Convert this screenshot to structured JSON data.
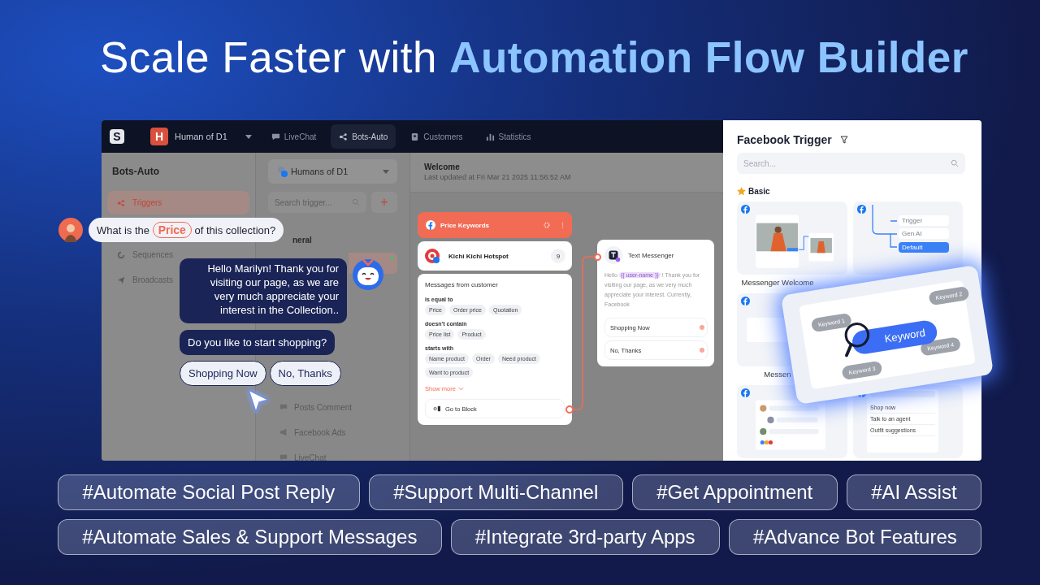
{
  "title": {
    "lead": "Scale Faster with",
    "accent": "Automation Flow Builder"
  },
  "app": {
    "logo": "S",
    "workspace": {
      "initial": "H",
      "name": "Human of D1"
    },
    "nav": [
      {
        "label": "LiveChat",
        "selected": false
      },
      {
        "label": "Bots-Auto",
        "selected": true
      },
      {
        "label": "Customers",
        "selected": false
      },
      {
        "label": "Statistics",
        "selected": false
      }
    ],
    "sidebar": {
      "title": "Bots-Auto",
      "items": [
        {
          "label": "Triggers",
          "selected": true
        },
        {
          "label": "Sequences",
          "selected": false
        },
        {
          "label": "Broadcasts",
          "selected": false
        }
      ]
    },
    "triggers": {
      "page": "Humans of D1",
      "search_placeholder": "Search trigger...",
      "add": "+",
      "group": "neral",
      "channels": [
        "Posts Comment",
        "Facebook Ads",
        "LiveChat"
      ]
    },
    "canvas": {
      "title": "Welcome",
      "updated": "Last updated at Fri Mar 21 2025 11:56:52 AM",
      "trigger_node": {
        "title": "Price Keywords",
        "page": "Kichi Kichi Hotspot",
        "count": "9",
        "heading": "Messages from customer",
        "rules": [
          {
            "label": "is equal to",
            "tags": [
              "Price",
              "Order price",
              "Quotation"
            ]
          },
          {
            "label": "doesn't contain",
            "tags": [
              "Price list",
              "Product"
            ]
          },
          {
            "label": "starts with",
            "tags": [
              "Name product",
              "Order",
              "Need product",
              "Want to product"
            ]
          }
        ],
        "more": "Show more",
        "action": "Go to Block"
      },
      "message_node": {
        "title": "Text Messenger",
        "greeting": "Hello",
        "variable": "{{ user-name }}",
        "mark": "!",
        "body": "Thank you for visiting our page, as we very much appreciate your interest. Currently, Facebook",
        "buttons": [
          "Shopping Now",
          "No, Thanks"
        ]
      }
    }
  },
  "panel": {
    "title": "Facebook Trigger",
    "search_placeholder": "Search...",
    "section": "Basic",
    "templates": [
      {
        "kind": "post",
        "label": "Messenger Welcome"
      },
      {
        "kind": "flow",
        "steps": [
          "Trigger",
          "Gen AI",
          "Default"
        ]
      },
      {
        "kind": "link",
        "label": "Messen"
      },
      {
        "kind": "comments"
      },
      {
        "kind": "chat",
        "options": [
          "Shop now",
          "Talk to an agent",
          "Outfit suggestions"
        ]
      }
    ]
  },
  "keyword_card": {
    "keywords": [
      "Keyword 1",
      "Keyword 2",
      "Keyword 3",
      "Keyword 4"
    ],
    "focus": "Keyword"
  },
  "chat": {
    "question": {
      "before": "What is the",
      "highlight": "Price",
      "after": "of this collection?"
    },
    "replies": [
      "Hello Marilyn! Thank you for visiting our page, as we are very much appreciate your interest in the Collection..",
      "Do you like to start shopping?"
    ],
    "quick_replies": [
      "Shopping Now",
      "No, Thanks"
    ]
  },
  "tags": [
    [
      "#Automate Social Post Reply",
      "#Support Multi-Channel",
      "#Get Appointment",
      "#AI Assist"
    ],
    [
      "#Automate Sales & Support Messages",
      "#Integrate 3rd-party Apps",
      "#Advance Bot Features"
    ]
  ]
}
